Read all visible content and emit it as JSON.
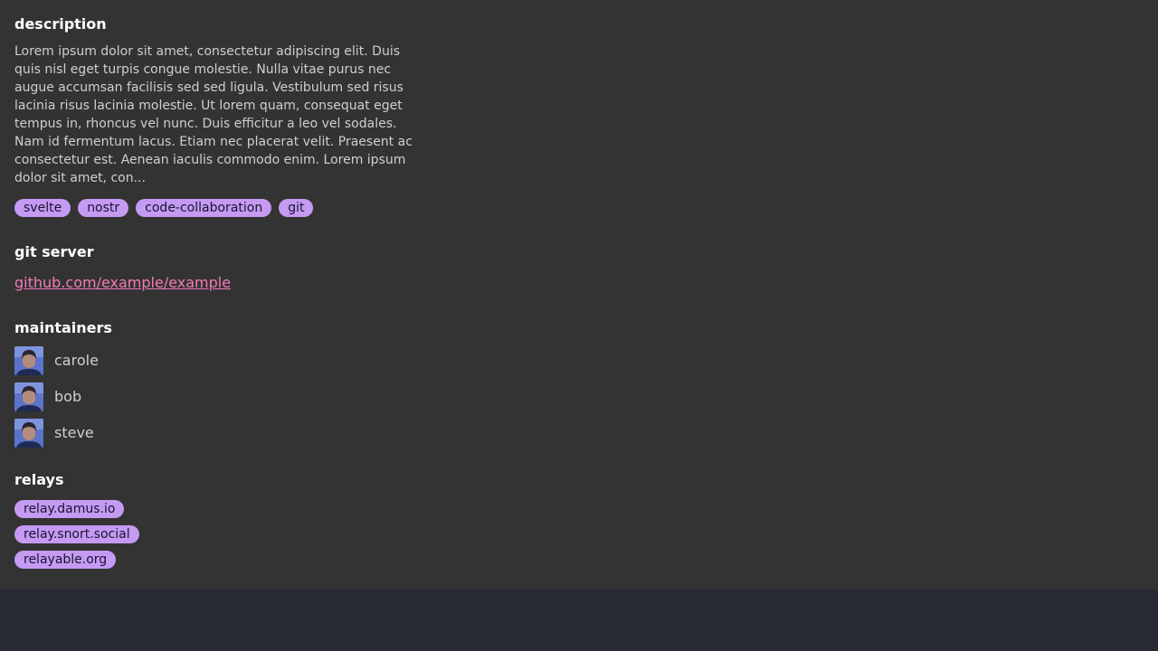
{
  "description": {
    "title": "description",
    "text": "Lorem ipsum dolor sit amet, consectetur adipiscing elit. Duis quis nisl eget turpis congue molestie. Nulla vitae purus nec augue accumsan facilisis sed sed ligula. Vestibulum sed risus lacinia risus lacinia molestie. Ut lorem quam, consequat eget tempus in, rhoncus vel nunc. Duis efficitur a leo vel sodales. Nam id fermentum lacus. Etiam nec placerat velit. Praesent ac consectetur est. Aenean iaculis commodo enim. Lorem ipsum dolor sit amet, con...",
    "tags": [
      "svelte",
      "nostr",
      "code-collaboration",
      "git"
    ]
  },
  "git_server": {
    "title": "git server",
    "url": "github.com/example/example"
  },
  "maintainers": {
    "title": "maintainers",
    "people": [
      {
        "name": "carole",
        "avatar_icon": "user-avatar-icon"
      },
      {
        "name": "bob",
        "avatar_icon": "user-avatar-icon"
      },
      {
        "name": "steve",
        "avatar_icon": "user-avatar-icon"
      }
    ]
  },
  "relays": {
    "title": "relays",
    "items": [
      "relay.damus.io",
      "relay.snort.social",
      "relayable.org"
    ]
  },
  "colors": {
    "panel_background": "#333333",
    "page_background": "#282a36",
    "pill_background": "#c49af3",
    "link": "#f57ab8",
    "heading": "#ffffff"
  }
}
